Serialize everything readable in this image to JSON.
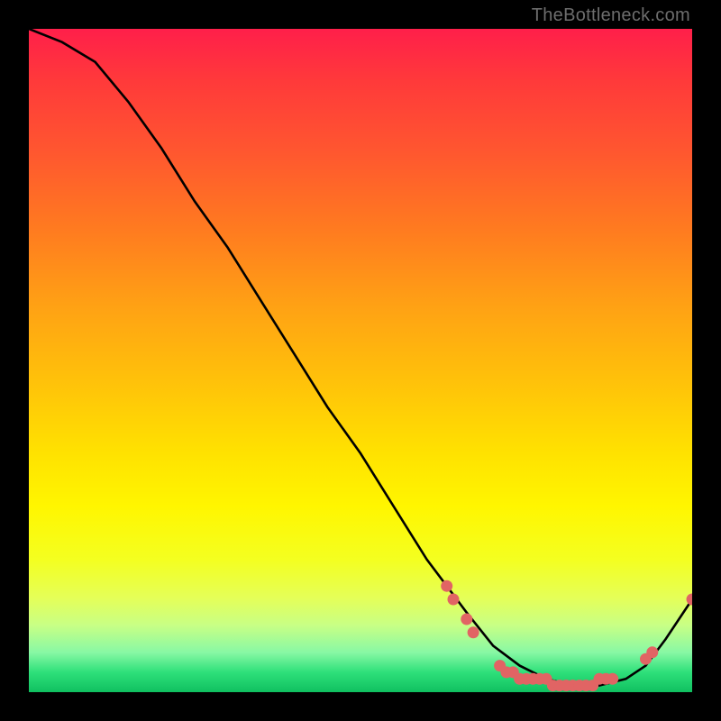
{
  "watermark": "TheBottleneck.com",
  "chart_data": {
    "type": "line",
    "title": "",
    "xlabel": "",
    "ylabel": "",
    "xlim": [
      0,
      100
    ],
    "ylim": [
      0,
      100
    ],
    "series": [
      {
        "name": "curve",
        "x": [
          0,
          5,
          10,
          15,
          20,
          25,
          30,
          35,
          40,
          45,
          50,
          55,
          60,
          63,
          66,
          70,
          74,
          78,
          82,
          86,
          90,
          93,
          96,
          100
        ],
        "y": [
          100,
          98,
          95,
          89,
          82,
          74,
          67,
          59,
          51,
          43,
          36,
          28,
          20,
          16,
          12,
          7,
          4,
          2,
          1,
          1,
          2,
          4,
          8,
          14
        ]
      }
    ],
    "markers": [
      {
        "x": 63,
        "y": 16
      },
      {
        "x": 64,
        "y": 14
      },
      {
        "x": 66,
        "y": 11
      },
      {
        "x": 67,
        "y": 9
      },
      {
        "x": 71,
        "y": 4
      },
      {
        "x": 72,
        "y": 3
      },
      {
        "x": 73,
        "y": 3
      },
      {
        "x": 74,
        "y": 2
      },
      {
        "x": 75,
        "y": 2
      },
      {
        "x": 76,
        "y": 2
      },
      {
        "x": 77,
        "y": 2
      },
      {
        "x": 78,
        "y": 2
      },
      {
        "x": 79,
        "y": 1
      },
      {
        "x": 80,
        "y": 1
      },
      {
        "x": 81,
        "y": 1
      },
      {
        "x": 82,
        "y": 1
      },
      {
        "x": 83,
        "y": 1
      },
      {
        "x": 84,
        "y": 1
      },
      {
        "x": 85,
        "y": 1
      },
      {
        "x": 86,
        "y": 2
      },
      {
        "x": 87,
        "y": 2
      },
      {
        "x": 88,
        "y": 2
      },
      {
        "x": 93,
        "y": 5
      },
      {
        "x": 94,
        "y": 6
      },
      {
        "x": 100,
        "y": 14
      }
    ],
    "marker_color": "#e16464",
    "curve_color": "#000000"
  }
}
